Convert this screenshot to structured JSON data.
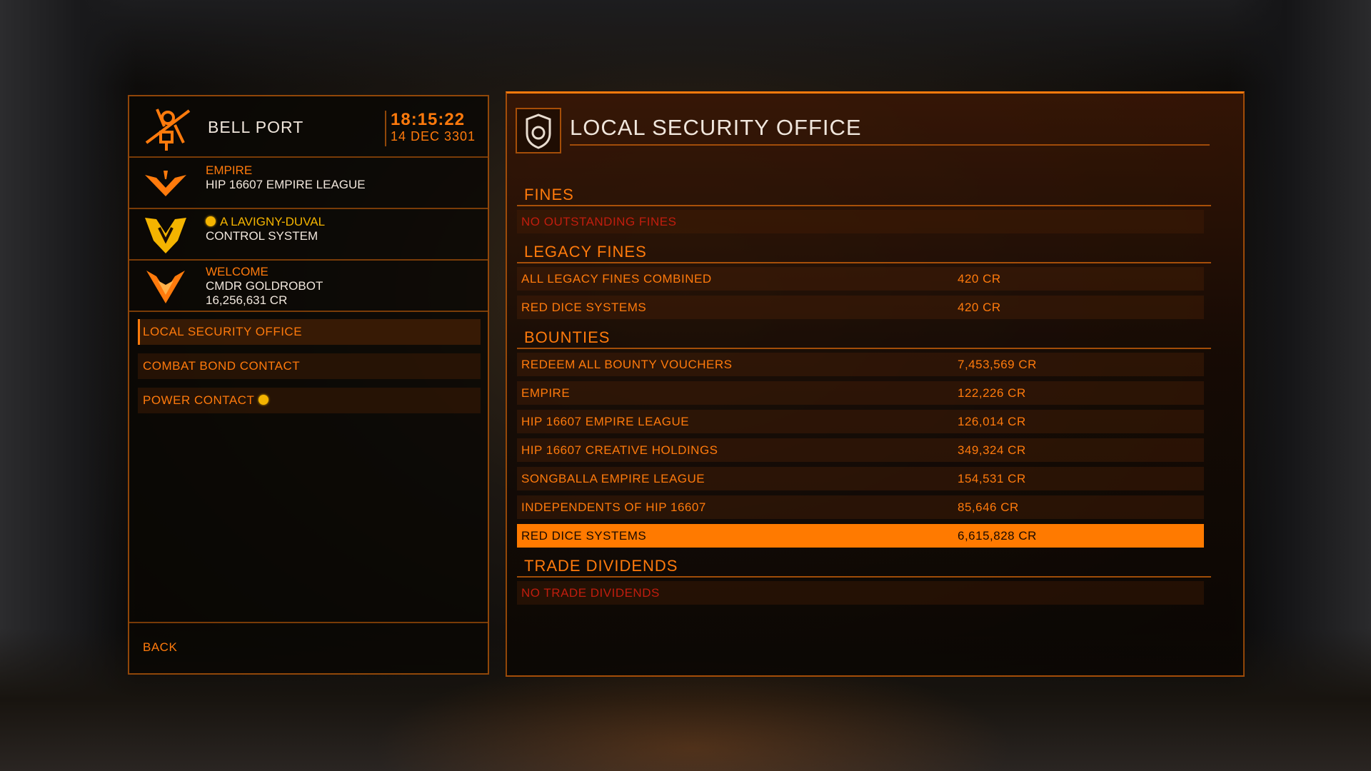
{
  "station": {
    "name": "BELL PORT",
    "time": "18:15:22",
    "date": "14 DEC 3301"
  },
  "faction": {
    "allegiance_label": "EMPIRE",
    "name": "HIP 16607 EMPIRE LEAGUE"
  },
  "power": {
    "name": "A LAVIGNY-DUVAL",
    "state": "CONTROL SYSTEM",
    "dot_color": "#f4b400"
  },
  "commander": {
    "greeting": "WELCOME",
    "name": "CMDR GOLDROBOT",
    "credits": "16,256,631 CR"
  },
  "menu": {
    "items": [
      {
        "label": "LOCAL SECURITY OFFICE"
      },
      {
        "label": "COMBAT BOND CONTACT"
      },
      {
        "label": "POWER CONTACT"
      }
    ],
    "back_label": "BACK"
  },
  "office": {
    "title": "LOCAL SECURITY OFFICE",
    "fines": {
      "heading": "FINES",
      "empty_text": "NO OUTSTANDING FINES"
    },
    "legacy_fines": {
      "heading": "LEGACY FINES",
      "rows": [
        {
          "label": "ALL LEGACY FINES COMBINED",
          "value": "420 CR"
        },
        {
          "label": "RED DICE SYSTEMS",
          "value": "420 CR"
        }
      ]
    },
    "bounties": {
      "heading": "BOUNTIES",
      "rows": [
        {
          "label": "REDEEM ALL BOUNTY VOUCHERS",
          "value": "7,453,569 CR"
        },
        {
          "label": "EMPIRE",
          "value": "122,226 CR"
        },
        {
          "label": "HIP 16607 EMPIRE LEAGUE",
          "value": "126,014 CR"
        },
        {
          "label": "HIP 16607 CREATIVE HOLDINGS",
          "value": "349,324 CR"
        },
        {
          "label": "SONGBALLA EMPIRE LEAGUE",
          "value": "154,531 CR"
        },
        {
          "label": "INDEPENDENTS OF HIP 16607",
          "value": "85,646 CR"
        },
        {
          "label": "RED DICE SYSTEMS",
          "value": "6,615,828 CR"
        }
      ]
    },
    "trade_dividends": {
      "heading": "TRADE DIVIDENDS",
      "empty_text": "NO TRADE DIVIDENDS"
    }
  },
  "colors": {
    "accent": "#ff7a0c",
    "selected_row": "#ff7a00",
    "empty_text": "#c21d0e",
    "primary_text": "#f0e6dc"
  }
}
